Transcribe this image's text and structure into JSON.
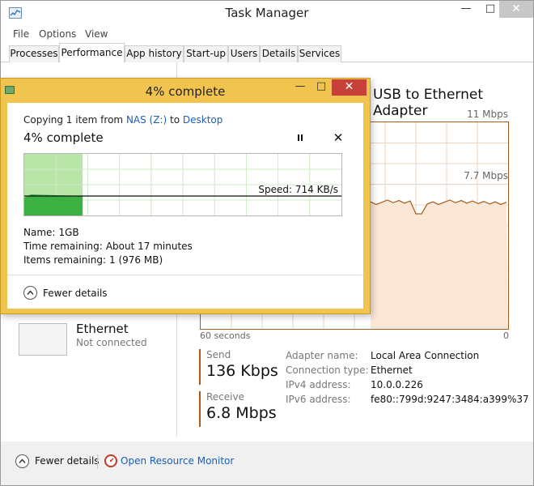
{
  "task_manager": {
    "title": "Task Manager",
    "menu": [
      "File",
      "Options",
      "View"
    ],
    "tabs": [
      {
        "label": "Processes",
        "active": false
      },
      {
        "label": "Performance",
        "active": true
      },
      {
        "label": "App history",
        "active": false
      },
      {
        "label": "Start-up",
        "active": false
      },
      {
        "label": "Users",
        "active": false
      },
      {
        "label": "Details",
        "active": false
      },
      {
        "label": "Services",
        "active": false
      }
    ],
    "adapter_title": "USB to Ethernet Adapter",
    "graph": {
      "max_label": "11 Mbps",
      "mid_label": "7.7 Mbps",
      "x_left_label": "60 seconds",
      "x_right_label": "0",
      "line_color": "#a85a1c",
      "fill_color": "#fbe7d6",
      "grid_color": "#f0d3bd"
    },
    "side_item": {
      "name": "Ethernet",
      "status": "Not connected"
    },
    "send": {
      "label": "Send",
      "value": "136 Kbps"
    },
    "receive": {
      "label": "Receive",
      "value": "6.8 Mbps"
    },
    "properties": [
      {
        "label": "Adapter name:",
        "value": "Local Area Connection"
      },
      {
        "label": "Connection type:",
        "value": "Ethernet"
      },
      {
        "label": "IPv4 address:",
        "value": "10.0.0.226"
      },
      {
        "label": "IPv6 address:",
        "value": "fe80::799d:9247:3484:a399%37"
      }
    ],
    "footer": {
      "fewer_details": "Fewer details",
      "resource_monitor": "Open Resource Monitor"
    }
  },
  "copy_dialog": {
    "title": "4% complete",
    "copy_prefix": "Copying 1 item from ",
    "source": "NAS (Z:)",
    "copy_mid": " to ",
    "destination": "Desktop",
    "percent_text": "4% complete",
    "progress_fraction": 0.04,
    "speed_text": "Speed: 714 KB/s",
    "name_label": "Name:",
    "name_value": "1GB",
    "time_label": "Time remaining:",
    "time_value": "About 17 minutes",
    "items_label": "Items remaining:",
    "items_value": "1 (976 MB)",
    "fewer_details": "Fewer details",
    "accent_color": "#3cb043"
  }
}
